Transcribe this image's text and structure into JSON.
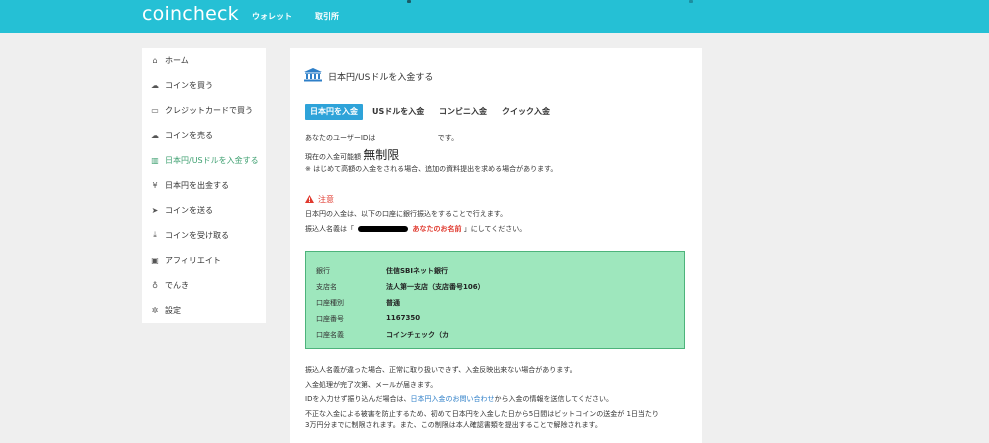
{
  "header": {
    "logo": "coincheck",
    "nav": [
      "ウォレット",
      "取引所"
    ]
  },
  "sidebar": {
    "items": [
      {
        "label": "ホーム",
        "icon": "home-icon",
        "glyph": "⌂"
      },
      {
        "label": "コインを買う",
        "icon": "cloud-download-icon",
        "glyph": "☁"
      },
      {
        "label": "クレジットカードで買う",
        "icon": "credit-card-icon",
        "glyph": "▭"
      },
      {
        "label": "コインを売る",
        "icon": "cloud-upload-icon",
        "glyph": "☁"
      },
      {
        "label": "日本円/USドルを入金する",
        "icon": "bank-icon",
        "glyph": "▥",
        "active": true
      },
      {
        "label": "日本円を出金する",
        "icon": "yen-icon",
        "glyph": "¥"
      },
      {
        "label": "コインを送る",
        "icon": "send-icon",
        "glyph": "➤"
      },
      {
        "label": "コインを受け取る",
        "icon": "download-icon",
        "glyph": "⤓"
      },
      {
        "label": "アフィリエイト",
        "icon": "gift-icon",
        "glyph": "▣"
      },
      {
        "label": "でんき",
        "icon": "bulb-icon",
        "glyph": "♁"
      },
      {
        "label": "設定",
        "icon": "gear-icon",
        "glyph": "✲"
      }
    ]
  },
  "main": {
    "title": "日本円/USドルを入金する",
    "tabs": [
      {
        "label": "日本円を入金",
        "active": true
      },
      {
        "label": "USドルを入金"
      },
      {
        "label": "コンビニ入金"
      },
      {
        "label": "クイック入金"
      }
    ],
    "user_id_prefix": "あなたのユーザーIDは",
    "user_id_suffix": "です。",
    "limit_label": "現在の入金可能額",
    "limit_value": "無制限",
    "note": "※ はじめて高額の入金をされる場合、追加の資料提出を求める場合があります。",
    "caution_title": "注意",
    "caution_line1": "日本円の入金は、以下の口座に銀行振込をすることで行えます。",
    "caution_line2_prefix": "振込人名義は「",
    "caution_line2_name": "あなたのお名前",
    "caution_line2_suffix": "」にしてください。",
    "bank": {
      "rows": [
        {
          "label": "銀行",
          "value": "住信SBIネット銀行"
        },
        {
          "label": "支店名",
          "value": "法人第一支店（支店番号106）"
        },
        {
          "label": "口座種別",
          "value": "普通"
        },
        {
          "label": "口座番号",
          "value": "1167350"
        },
        {
          "label": "口座名義",
          "value": "コインチェック（カ"
        }
      ]
    },
    "footer1": "振込人名義が違った場合、正常に取り扱いできず、入金反映出来ない場合があります。",
    "footer2": "入金処理が完了次第、メールが届きます。",
    "footer3_prefix": "IDを入力せず振り込んだ場合は、",
    "footer3_link": "日本円入金のお問い合わせ",
    "footer3_suffix": "から入金の情報を送信してください。",
    "footer4": "不正な入金による被害を防止するため、初めて日本円を入金した日から5日間はビットコインの送金が 1日当たり",
    "footer5": "3万円分までに制限されます。また、この制限は本人確認書類を提出することで解除されます。"
  },
  "colors": {
    "header": "#25c0d5",
    "active_tab": "#2ea3d9",
    "sidebar_active": "#3c9f6f",
    "bank_box": "#9ee7bd",
    "warning": "#e03a2f",
    "link": "#2e7fc8"
  }
}
